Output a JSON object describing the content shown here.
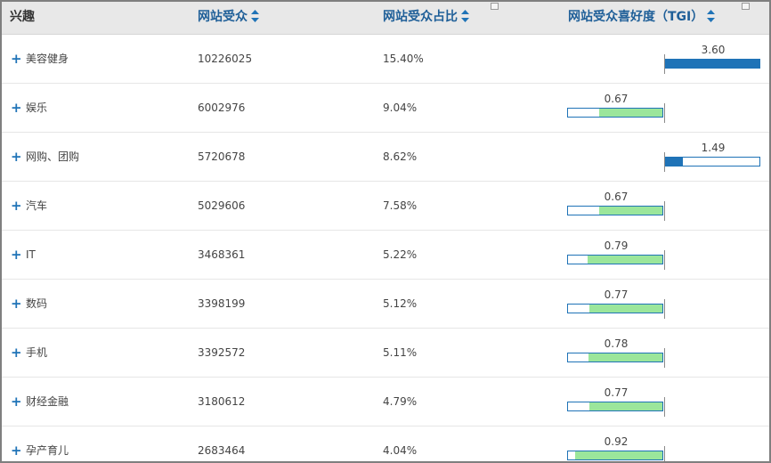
{
  "header": {
    "interest": "兴趣",
    "audience": "网站受众",
    "share": "网站受众占比",
    "tgi": "网站受众喜好度（TGI）"
  },
  "rows": [
    {
      "interest": "美容健身",
      "audience": "10226025",
      "share": "15.40%",
      "tgi": 3.6,
      "tgi_label": "3.60",
      "expand_icon": "+"
    },
    {
      "interest": "娱乐",
      "audience": "6002976",
      "share": "9.04%",
      "tgi": 0.67,
      "tgi_label": "0.67",
      "expand_icon": "+"
    },
    {
      "interest": "网购、团购",
      "audience": "5720678",
      "share": "8.62%",
      "tgi": 1.49,
      "tgi_label": "1.49",
      "expand_icon": "+"
    },
    {
      "interest": "汽车",
      "audience": "5029606",
      "share": "7.58%",
      "tgi": 0.67,
      "tgi_label": "0.67",
      "expand_icon": "+"
    },
    {
      "interest": "IT",
      "audience": "3468361",
      "share": "5.22%",
      "tgi": 0.79,
      "tgi_label": "0.79",
      "expand_icon": "+"
    },
    {
      "interest": "数码",
      "audience": "3398199",
      "share": "5.12%",
      "tgi": 0.77,
      "tgi_label": "0.77",
      "expand_icon": "+"
    },
    {
      "interest": "手机",
      "audience": "3392572",
      "share": "5.11%",
      "tgi": 0.78,
      "tgi_label": "0.78",
      "expand_icon": "+"
    },
    {
      "interest": "财经金融",
      "audience": "3180612",
      "share": "4.79%",
      "tgi": 0.77,
      "tgi_label": "0.77",
      "expand_icon": "+"
    },
    {
      "interest": "孕产育儿",
      "audience": "2683464",
      "share": "4.04%",
      "tgi": 0.92,
      "tgi_label": "0.92",
      "expand_icon": "+"
    }
  ],
  "colors": {
    "header_bg": "#e8e8e8",
    "header_text": "#1f5f98",
    "tgi_above_fill": "#1f73b7",
    "tgi_below_fill": "#9be69b",
    "bar_border": "#1f73b7",
    "expand_icon": "#1f73b7"
  },
  "icons": {
    "sort": "sort-up-down-icon",
    "expand": "plus-icon",
    "column_menu": "column-menu-icon"
  }
}
